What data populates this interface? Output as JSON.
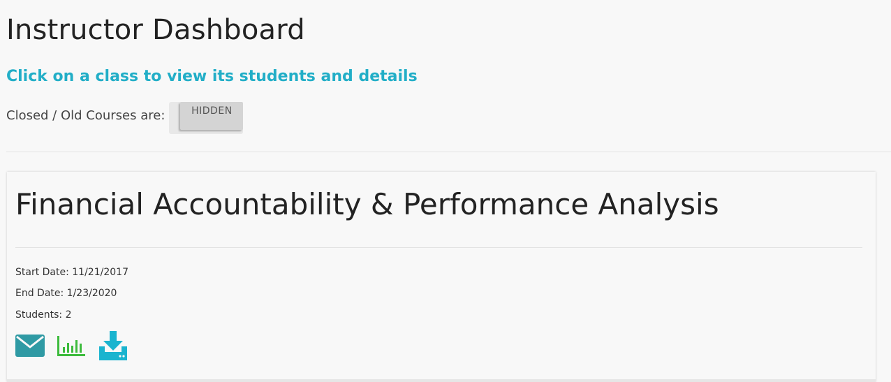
{
  "page": {
    "title": "Instructor Dashboard",
    "subtitle": "Click on a class to view its students and details"
  },
  "toggle": {
    "label": "Closed / Old Courses are:",
    "state": "HIDDEN"
  },
  "courses": [
    {
      "title": "Financial Accountability & Performance Analysis",
      "start_date": "Start Date: 11/21/2017",
      "end_date": "End Date: 1/23/2020",
      "students": "Students: 2",
      "actions": {
        "email_icon": "envelope-icon",
        "report_icon": "bar-chart-icon",
        "download_icon": "download-icon"
      }
    }
  ],
  "colors": {
    "accent": "#22aec7",
    "mail_icon": "#2f9aa4",
    "chart_icon": "#3dbb3d",
    "download_icon": "#1ab4cf"
  }
}
